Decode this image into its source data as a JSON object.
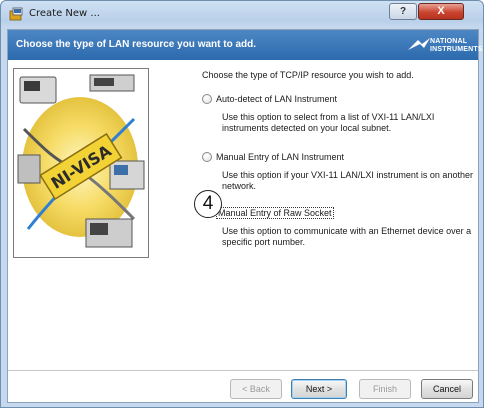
{
  "window": {
    "title": "Create New ...",
    "help_label": "?",
    "close_label": "X"
  },
  "header": {
    "title": "Choose the type of LAN resource you want to add.",
    "logo_line1": "NATIONAL",
    "logo_line2": "INSTRUMENTS"
  },
  "hero": {
    "badge_text": "NI-VISA"
  },
  "content": {
    "prompt": "Choose the type of TCP/IP resource you wish to add.",
    "options": [
      {
        "label": "Auto-detect of LAN Instrument",
        "description": "Use this option to select from a list of VXI-11 LAN/LXI instruments detected on your local subnet.",
        "selected": false
      },
      {
        "label": "Manual Entry of LAN Instrument",
        "description": "Use this option if your VXI-11 LAN/LXI instrument is on another network.",
        "selected": false
      },
      {
        "label": "Manual Entry of Raw Socket",
        "description": "Use this option to communicate with an Ethernet device over a specific port number.",
        "selected": true
      }
    ]
  },
  "callout": {
    "number": "4"
  },
  "footer": {
    "back_label": "< Back",
    "next_label": "Next >",
    "finish_label": "Finish",
    "cancel_label": "Cancel"
  }
}
